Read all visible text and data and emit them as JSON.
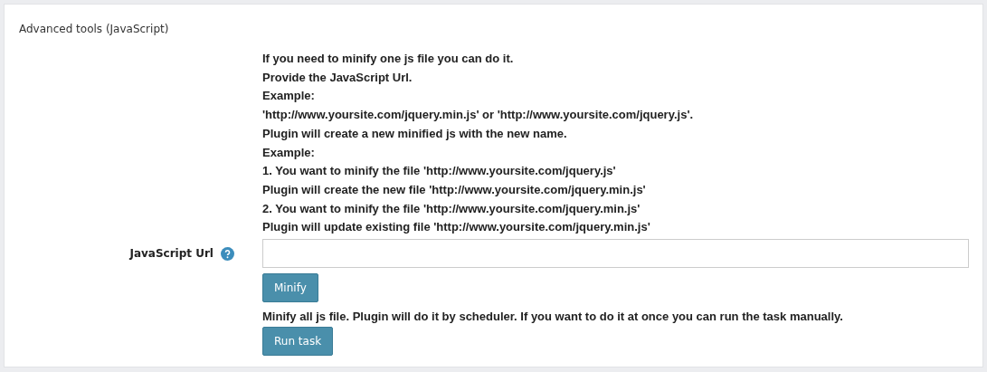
{
  "panel": {
    "title": "Advanced tools (JavaScript)"
  },
  "description": [
    "If you need to minify one js file you can do it.",
    "Provide the JavaScript Url.",
    "Example:",
    "'http://www.yoursite.com/jquery.min.js' or 'http://www.yoursite.com/jquery.js'.",
    "Plugin will create a new minified js with the new name.",
    "Example:",
    "1. You want to minify the file 'http://www.yoursite.com/jquery.js'",
    "Plugin will create the new file 'http://www.yoursite.com/jquery.min.js'",
    "2. You want to minify the file 'http://www.yoursite.com/jquery.min.js'",
    "Plugin will update existing file 'http://www.yoursite.com/jquery.min.js'"
  ],
  "url_field": {
    "label": "JavaScript Url"
  },
  "minify_button": "Minify",
  "scheduler_note": "Minify all js file. Plugin will do it by scheduler. If you want to do it at once you can run the task manually.",
  "run_button": "Run task"
}
